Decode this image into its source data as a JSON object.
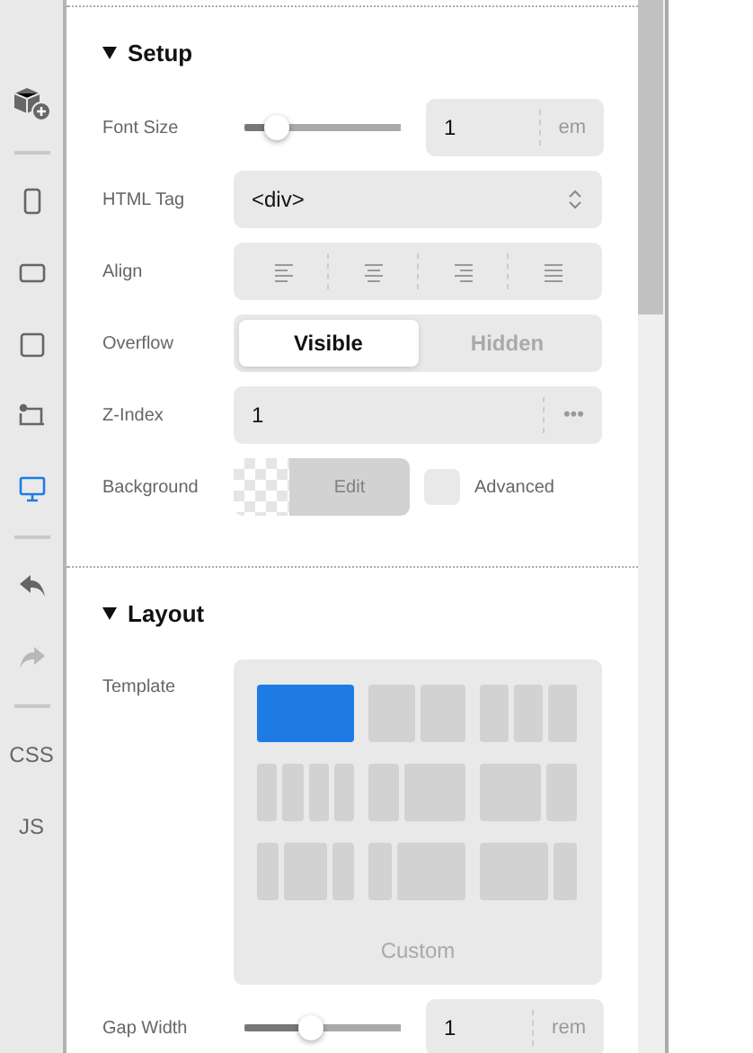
{
  "sidebar": {
    "items": [
      {
        "kind": "addblock"
      },
      {
        "kind": "divider"
      },
      {
        "kind": "phone",
        "selected": false
      },
      {
        "kind": "tablet",
        "selected": false
      },
      {
        "kind": "square",
        "selected": false
      },
      {
        "kind": "laptop",
        "selected": false
      },
      {
        "kind": "desktop",
        "selected": true
      },
      {
        "kind": "divider"
      },
      {
        "kind": "undo",
        "disabled": false
      },
      {
        "kind": "redo",
        "disabled": true
      },
      {
        "kind": "divider"
      },
      {
        "kind": "text",
        "label": "CSS"
      },
      {
        "kind": "text",
        "label": "JS"
      }
    ]
  },
  "sections": [
    {
      "title": "Setup",
      "expanded": true,
      "rows": [
        {
          "kind": "slider",
          "label": "Font Size",
          "level": 0.14,
          "value": "1",
          "unit": "em"
        },
        {
          "kind": "select",
          "label": "HTML Tag",
          "value": "<div>"
        },
        {
          "kind": "align",
          "label": "Align",
          "options": [
            {
              "kind": "left",
              "selected": false
            },
            {
              "kind": "center",
              "selected": false
            },
            {
              "kind": "right",
              "selected": false
            },
            {
              "kind": "justify",
              "selected": false
            }
          ]
        },
        {
          "kind": "toggle",
          "label": "Overflow",
          "options": [
            {
              "label": "Visible",
              "selected": true
            },
            {
              "label": "Hidden",
              "selected": false
            }
          ]
        },
        {
          "kind": "number",
          "label": "Z-Index",
          "value": "1",
          "menu": "•••"
        },
        {
          "kind": "background",
          "label": "Background",
          "button": "Edit",
          "checkbox": {
            "label": "Advanced",
            "checked": false
          }
        }
      ]
    },
    {
      "title": "Layout",
      "expanded": true,
      "rows": [
        {
          "kind": "template",
          "label": "Template",
          "options": [
            {
              "kind": "single",
              "selected": true
            },
            {
              "kind": "halves",
              "selected": false
            },
            {
              "kind": "thirds",
              "selected": false
            },
            {
              "kind": "quarters",
              "selected": false
            },
            {
              "kind": "narrowwide",
              "selected": false
            },
            {
              "kind": "widenarrow",
              "selected": false
            },
            {
              "kind": "centerwide",
              "selected": false
            },
            {
              "kind": "narrowwider",
              "selected": false
            },
            {
              "kind": "widernarrow",
              "selected": false
            }
          ],
          "custom": "Custom"
        },
        {
          "kind": "slider",
          "label": "Gap Width",
          "level": 0.36,
          "value": "1",
          "unit": "rem"
        }
      ]
    }
  ]
}
